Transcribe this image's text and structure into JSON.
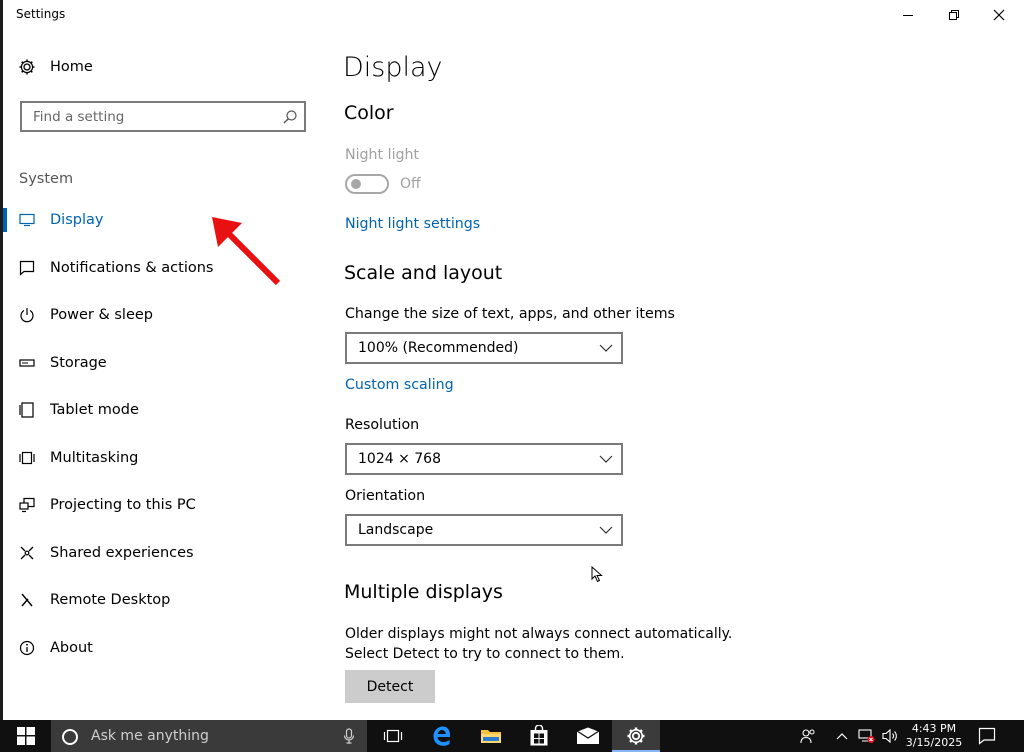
{
  "window": {
    "title": "Settings"
  },
  "sidebar": {
    "home_label": "Home",
    "search_placeholder": "Find a setting",
    "section_label": "System",
    "items": [
      {
        "label": "Display",
        "icon": "monitor-icon",
        "active": true
      },
      {
        "label": "Notifications & actions",
        "icon": "notification-icon"
      },
      {
        "label": "Power & sleep",
        "icon": "power-icon"
      },
      {
        "label": "Storage",
        "icon": "storage-icon"
      },
      {
        "label": "Tablet mode",
        "icon": "tablet-icon"
      },
      {
        "label": "Multitasking",
        "icon": "multitasking-icon"
      },
      {
        "label": "Projecting to this PC",
        "icon": "projecting-icon"
      },
      {
        "label": "Shared experiences",
        "icon": "shared-icon"
      },
      {
        "label": "Remote Desktop",
        "icon": "remote-desktop-icon"
      },
      {
        "label": "About",
        "icon": "info-icon"
      }
    ]
  },
  "main": {
    "page_title": "Display",
    "color": {
      "heading": "Color",
      "night_light_label": "Night light",
      "night_light_state": "Off",
      "night_light_settings_link": "Night light settings"
    },
    "scale": {
      "heading": "Scale and layout",
      "size_label": "Change the size of text, apps, and other items",
      "size_value": "100% (Recommended)",
      "custom_scaling_link": "Custom scaling",
      "resolution_label": "Resolution",
      "resolution_value": "1024 × 768",
      "orientation_label": "Orientation",
      "orientation_value": "Landscape"
    },
    "multiple": {
      "heading": "Multiple displays",
      "description": "Older displays might not always connect automatically. Select Detect to try to connect to them.",
      "detect_button": "Detect"
    }
  },
  "taskbar": {
    "search_placeholder": "Ask me anything",
    "time": "4:43 PM",
    "date": "3/15/2025"
  },
  "colors": {
    "accent": "#0063b1",
    "annotation_arrow": "#e81010",
    "taskbar": "#101010"
  }
}
